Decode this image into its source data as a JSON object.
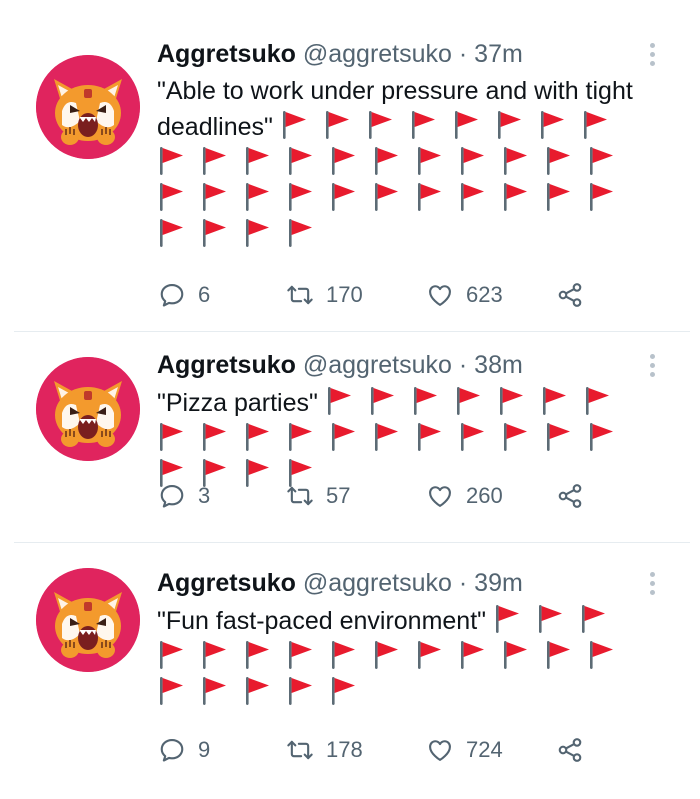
{
  "tweets": [
    {
      "author": "Aggretsuko",
      "handle": "@aggretsuko",
      "separator": "·",
      "time": "37m",
      "text": "\"Able to work under pressure and with tight deadlines\"",
      "flag_count": 34,
      "replies": "6",
      "retweets": "170",
      "likes": "623"
    },
    {
      "author": "Aggretsuko",
      "handle": "@aggretsuko",
      "separator": "·",
      "time": "38m",
      "text": "\"Pizza parties\"",
      "flag_count": 22,
      "replies": "3",
      "retweets": "57",
      "likes": "260"
    },
    {
      "author": "Aggretsuko",
      "handle": "@aggretsuko",
      "separator": "·",
      "time": "39m",
      "text": "\"Fun fast-paced environment\"",
      "flag_count": 19,
      "replies": "9",
      "retweets": "178",
      "likes": "724"
    }
  ],
  "icons": {
    "flag": "red-flag-icon",
    "reply": "reply-icon",
    "retweet": "retweet-icon",
    "like": "heart-icon",
    "share": "share-icon",
    "more": "more-options-icon"
  },
  "colors": {
    "flag_red": "#e81b2e",
    "flag_pole": "#5c6b75",
    "muted_text": "#536471",
    "avatar_bg": "#e0245e",
    "divider": "#e6ecf0"
  }
}
